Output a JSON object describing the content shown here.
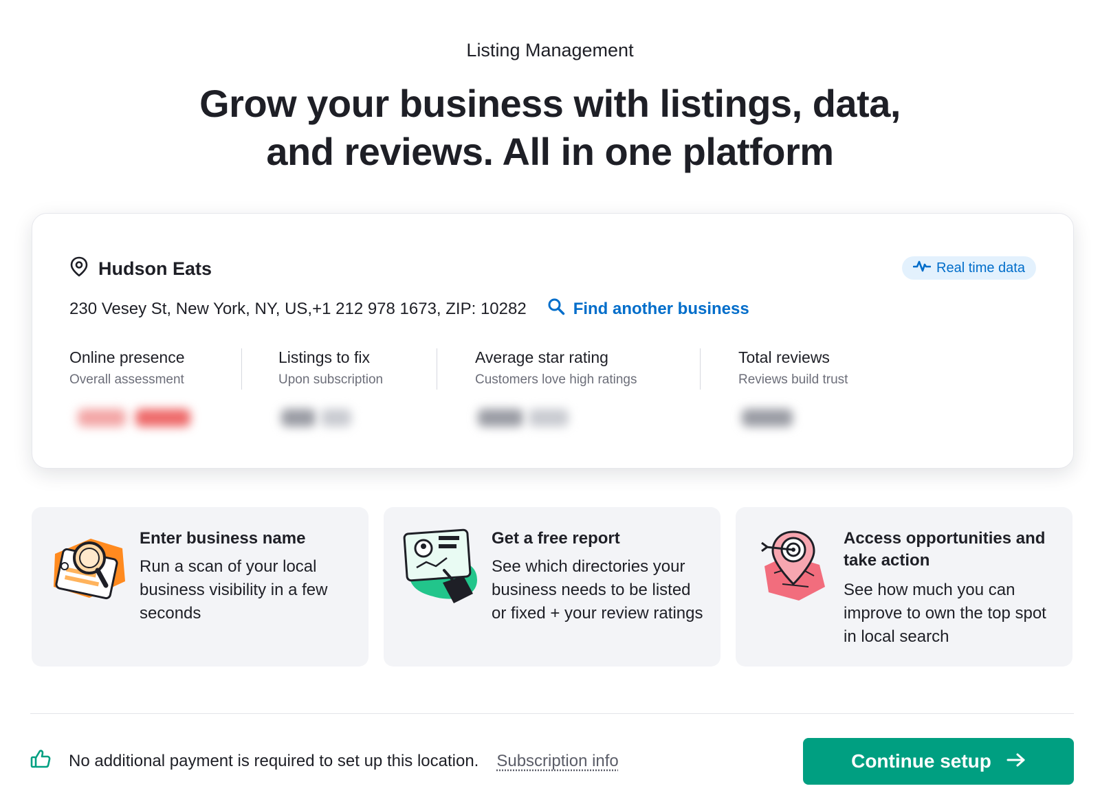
{
  "header": {
    "eyebrow": "Listing Management",
    "headline_line1": "Grow your business with listings, data,",
    "headline_line2": "and reviews. All in one platform"
  },
  "business": {
    "name": "Hudson Eats",
    "address": "230 Vesey St, New York, NY, US,+1 212 978 1673, ZIP: 10282",
    "find_link": "Find another business",
    "badge": "Real time data"
  },
  "metrics": [
    {
      "label": "Online presence",
      "sub": "Overall assessment"
    },
    {
      "label": "Listings to fix",
      "sub": "Upon subscription"
    },
    {
      "label": "Average star rating",
      "sub": "Customers love high ratings"
    },
    {
      "label": "Total reviews",
      "sub": "Reviews build trust"
    }
  ],
  "steps": [
    {
      "title": "Enter business name",
      "body": "Run a scan of your local business visibility in a few seconds"
    },
    {
      "title": "Get a free report",
      "body": "See which directories your business needs to be listed or fixed + your review ratings"
    },
    {
      "title": "Access opportunities and take action",
      "body": "See how much you can improve to own the top spot in local search"
    }
  ],
  "footer": {
    "note": "No additional payment is required to set up this location.",
    "link": "Subscription info",
    "cta": "Continue setup"
  },
  "colors": {
    "accent_blue": "#006dca",
    "cta_green": "#009f81",
    "card_bg": "#f3f4f7",
    "text": "#1e1f26"
  },
  "icons": [
    "pin-icon",
    "pulse-icon",
    "search-icon",
    "thumbs-up-icon",
    "arrow-right-icon"
  ]
}
